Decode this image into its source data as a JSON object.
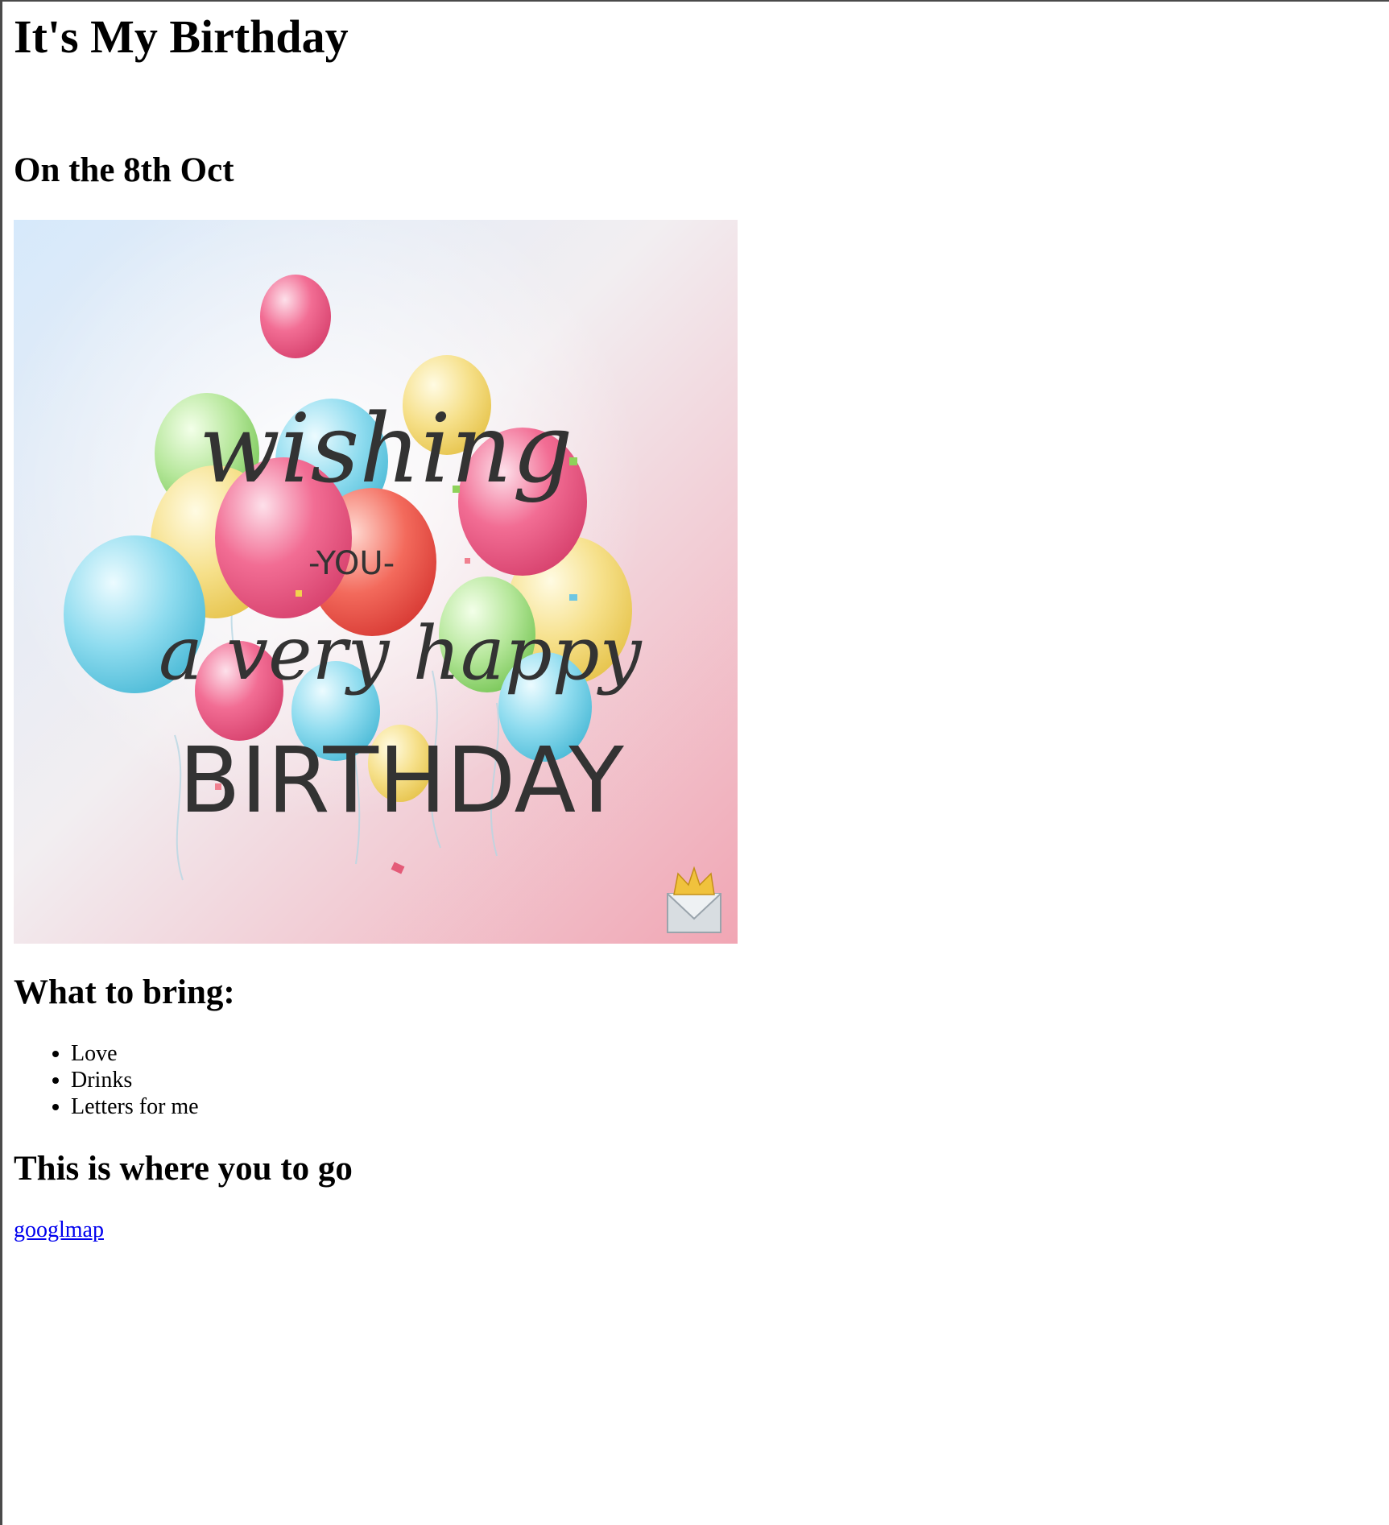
{
  "page": {
    "title": "It's My Birthday",
    "date_heading": "On the 8th Oct"
  },
  "card_image": {
    "icon": "birthday-balloons-card",
    "text_line1": "wishing",
    "text_line2": "-YOU-",
    "text_line3": "a very happy",
    "text_line4": "BIRTHDAY",
    "colors": {
      "background_top": "#dbe8f6",
      "background_bottom": "#f2a9b7",
      "pink": "#ef5d86",
      "yellow": "#f4d66f",
      "blue": "#7ed3ea",
      "green": "#a8e28a",
      "text": "#333333"
    }
  },
  "bring": {
    "heading": "What to bring:",
    "items": [
      "Love",
      "Drinks",
      "Letters for me"
    ]
  },
  "location": {
    "heading": "This is where you to go",
    "link_text": "googlmap",
    "link_color": "#0000ee"
  }
}
